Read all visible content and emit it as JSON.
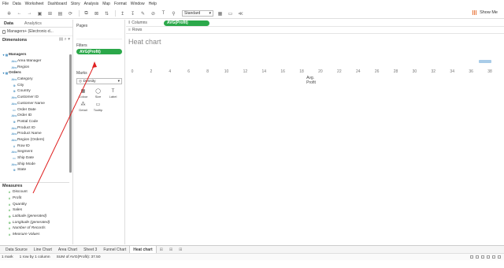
{
  "menu": [
    "File",
    "Data",
    "Worksheet",
    "Dashboard",
    "Story",
    "Analysis",
    "Map",
    "Format",
    "Window",
    "Help"
  ],
  "toolbar": {
    "fit_select": "Standard",
    "show_me": "Show Me"
  },
  "data_pane": {
    "tab_data": "Data",
    "tab_analytics": "Analytics",
    "source": "Managers+ (Electronic-d...",
    "dimensions_label": "Dimensions",
    "dimensions": [
      {
        "label": "Managers",
        "level": 0,
        "folder": true,
        "icon": "▾ ▦"
      },
      {
        "label": "Area Manager",
        "level": 2,
        "icon": "Abc"
      },
      {
        "label": "Region",
        "level": 2,
        "icon": "Abc"
      },
      {
        "label": "Orders",
        "level": 0,
        "folder": true,
        "icon": "▾ ▦"
      },
      {
        "label": "Category",
        "level": 2,
        "icon": "Abc"
      },
      {
        "label": "City",
        "level": 2,
        "icon": "⊕"
      },
      {
        "label": "Country",
        "level": 2,
        "icon": "⊕"
      },
      {
        "label": "Customer ID",
        "level": 2,
        "icon": "Abc"
      },
      {
        "label": "Customer Name",
        "level": 2,
        "icon": "Abc"
      },
      {
        "label": "Order Date",
        "level": 2,
        "icon": "▭"
      },
      {
        "label": "Order ID",
        "level": 2,
        "icon": "Abc"
      },
      {
        "label": "Postal Code",
        "level": 2,
        "icon": "⊕"
      },
      {
        "label": "Product ID",
        "level": 2,
        "icon": "Abc"
      },
      {
        "label": "Product Name",
        "level": 2,
        "icon": "Abc"
      },
      {
        "label": "Region (Orders)",
        "level": 2,
        "icon": "Abc"
      },
      {
        "label": "Row ID",
        "level": 2,
        "icon": "#"
      },
      {
        "label": "Segment",
        "level": 2,
        "icon": "Abc"
      },
      {
        "label": "Ship Date",
        "level": 2,
        "icon": "▭"
      },
      {
        "label": "Ship Mode",
        "level": 2,
        "icon": "Abc"
      },
      {
        "label": "State",
        "level": 2,
        "icon": "⊕"
      }
    ],
    "measures_label": "Measures",
    "measures": [
      {
        "label": "Discount",
        "icon": "#",
        "italic": false
      },
      {
        "label": "Profit",
        "icon": "#",
        "italic": false
      },
      {
        "label": "Quantity",
        "icon": "#",
        "italic": false
      },
      {
        "label": "Sales",
        "icon": "#",
        "italic": false
      },
      {
        "label": "Latitude (generated)",
        "icon": "⊕",
        "italic": true
      },
      {
        "label": "Longitude (generated)",
        "icon": "⊕",
        "italic": true
      },
      {
        "label": "Number of Records",
        "icon": "#",
        "italic": true
      },
      {
        "label": "Measure Values",
        "icon": "#",
        "italic": true
      }
    ]
  },
  "cards": {
    "pages": "Pages",
    "filters": "Filters",
    "filter_pill": "AVG(Profit)",
    "marks": "Marks",
    "marks_type": "Density",
    "mark_buttons": [
      {
        "label": "Colour",
        "icon": "▦"
      },
      {
        "label": "Size",
        "icon": "◯"
      },
      {
        "label": "Label",
        "icon": "T"
      },
      {
        "label": "Detail",
        "icon": "⁂"
      },
      {
        "label": "Tooltip",
        "icon": "▭"
      }
    ]
  },
  "shelves": {
    "columns_label": "Columns",
    "columns_pill": "AVG(Profit)",
    "rows_label": "Rows"
  },
  "view": {
    "title": "Heat chart"
  },
  "chart_data": {
    "type": "heatmap",
    "title": "Heat chart",
    "xlabel": "Avg. Profit",
    "ylabel": "",
    "xlim": [
      0,
      38
    ],
    "x_ticks": [
      0,
      2,
      4,
      6,
      8,
      10,
      12,
      14,
      16,
      18,
      20,
      22,
      24,
      26,
      28,
      30,
      32,
      34,
      36,
      38
    ],
    "values": [
      37.5
    ],
    "color": "#a9cce8"
  },
  "bottom_tabs": [
    "Data Source",
    "Line Chart",
    "Area Chart",
    "Sheet 3",
    "Funnel Chart",
    "Heat chart"
  ],
  "active_tab": "Heat chart",
  "status": {
    "marks": "1 mark",
    "rows_cols": "1 row by 1 column",
    "sum": "SUM of AVG(Profit): 37.50"
  }
}
